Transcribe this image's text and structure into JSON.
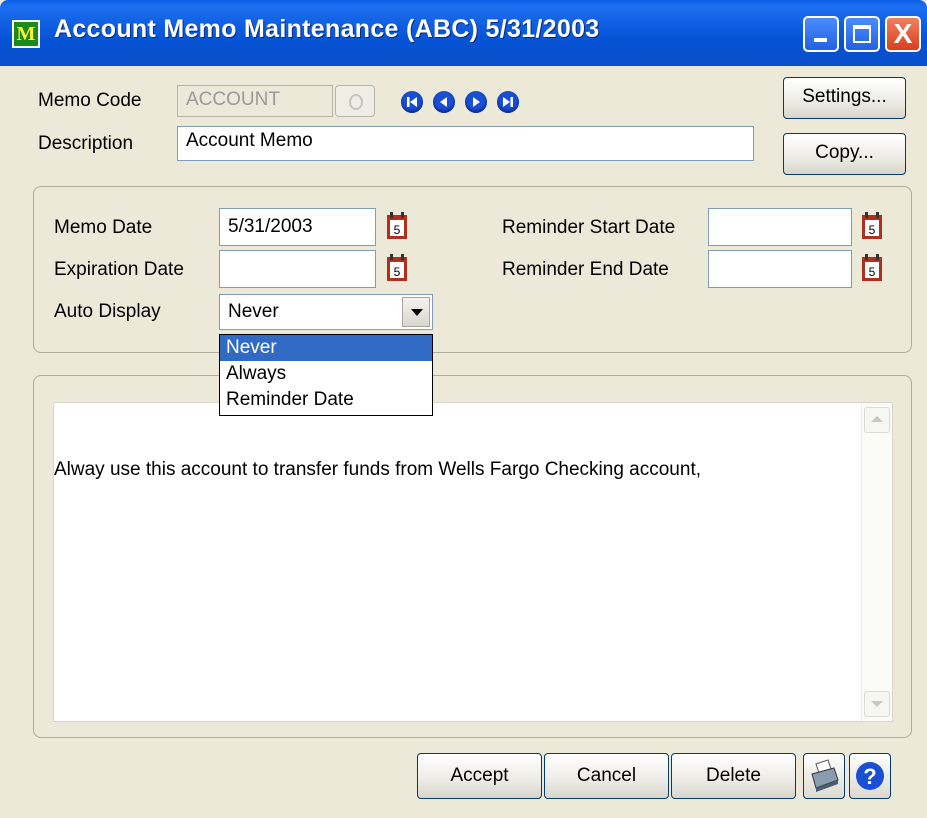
{
  "window": {
    "app_icon_letter": "M",
    "title": "Account Memo Maintenance (ABC) 5/31/2003",
    "close_glyph": "X"
  },
  "header": {
    "memo_code_label": "Memo Code",
    "memo_code_value": "ACCOUNT",
    "description_label": "Description",
    "description_value": "Account Memo",
    "settings_button": "Settings...",
    "copy_button": "Copy...",
    "nav_icons": [
      "first-record-icon",
      "previous-record-icon",
      "next-record-icon",
      "last-record-icon"
    ]
  },
  "dates": {
    "memo_date_label": "Memo Date",
    "memo_date_value": "5/31/2003",
    "expiration_date_label": "Expiration Date",
    "expiration_date_value": "",
    "reminder_start_label": "Reminder Start Date",
    "reminder_start_value": "",
    "reminder_end_label": "Reminder End Date",
    "reminder_end_value": "",
    "auto_display_label": "Auto Display",
    "auto_display_value": "Never",
    "auto_display_options": [
      "Never",
      "Always",
      "Reminder Date"
    ],
    "calendar_day": "5"
  },
  "memo": {
    "text": "Alway use this account to transfer funds from Wells Fargo Checking account,"
  },
  "footer": {
    "accept_button": "Accept",
    "cancel_button": "Cancel",
    "delete_button": "Delete",
    "help_glyph": "?"
  },
  "colors": {
    "title_bar": "#0553d6",
    "nav_button": "#1a4fd4",
    "selection": "#316ac5",
    "calendar_icon": "#b03020"
  }
}
